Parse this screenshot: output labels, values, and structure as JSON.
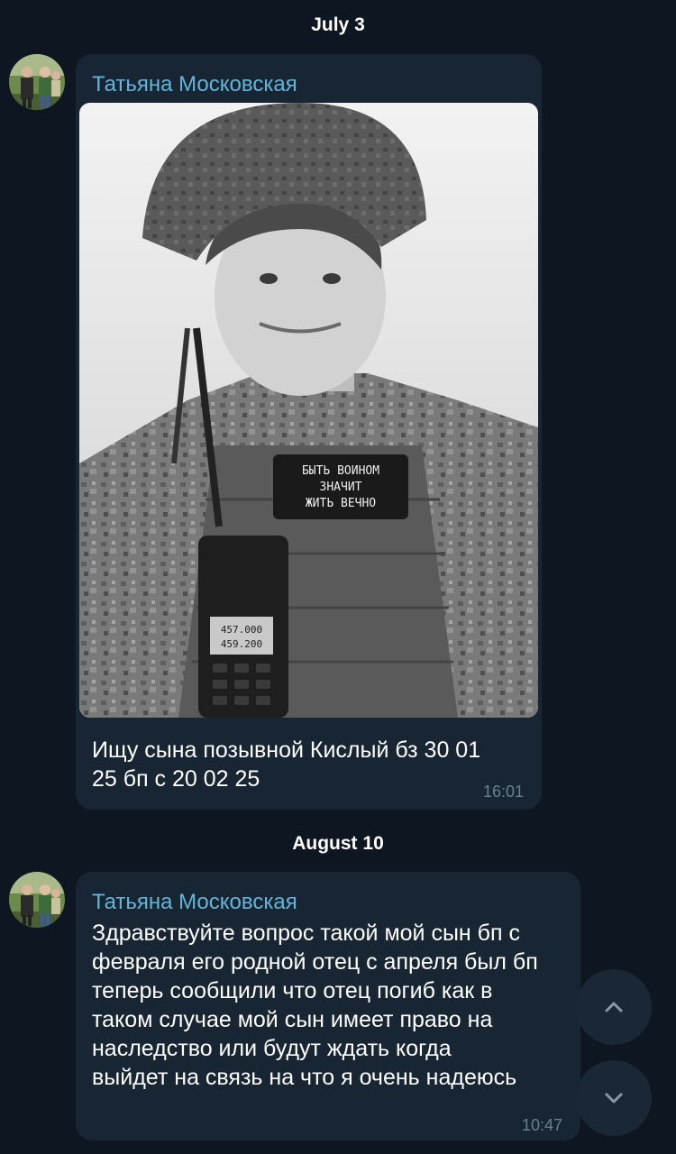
{
  "dates": {
    "first": "July 3",
    "second": "August 10"
  },
  "messages": [
    {
      "sender": "Татьяна Московская",
      "text": "Ищу сына позывной Кислый бз 30 01\n25 бп с 20 02 25",
      "time": "16:01",
      "photo_patch_text": "БЫТЬ ВОИНОМ\nЗНАЧИТ\nЖИТЬ ВЕЧНО",
      "radio_display_1": "457.000",
      "radio_display_2": "459.200"
    },
    {
      "sender": "Татьяна Московская",
      "text": "Здравствуйте вопрос такой мой сын бп с\nфевраля его родной отец с апреля был бп\nтеперь сообщили что отец погиб как в\nтаком случае мой сын имеет право на\nнаследство или будут ждать когда\nвыйдет на связь на что я очень надеюсь",
      "time": "10:47"
    }
  ],
  "scroll_buttons": {
    "up_icon": "chevron-up-icon",
    "down_icon": "chevron-down-icon"
  },
  "colors": {
    "background": "#0e1621",
    "bubble": "#182533",
    "sender_name": "#64b5d8",
    "time": "#6d7f8f"
  }
}
